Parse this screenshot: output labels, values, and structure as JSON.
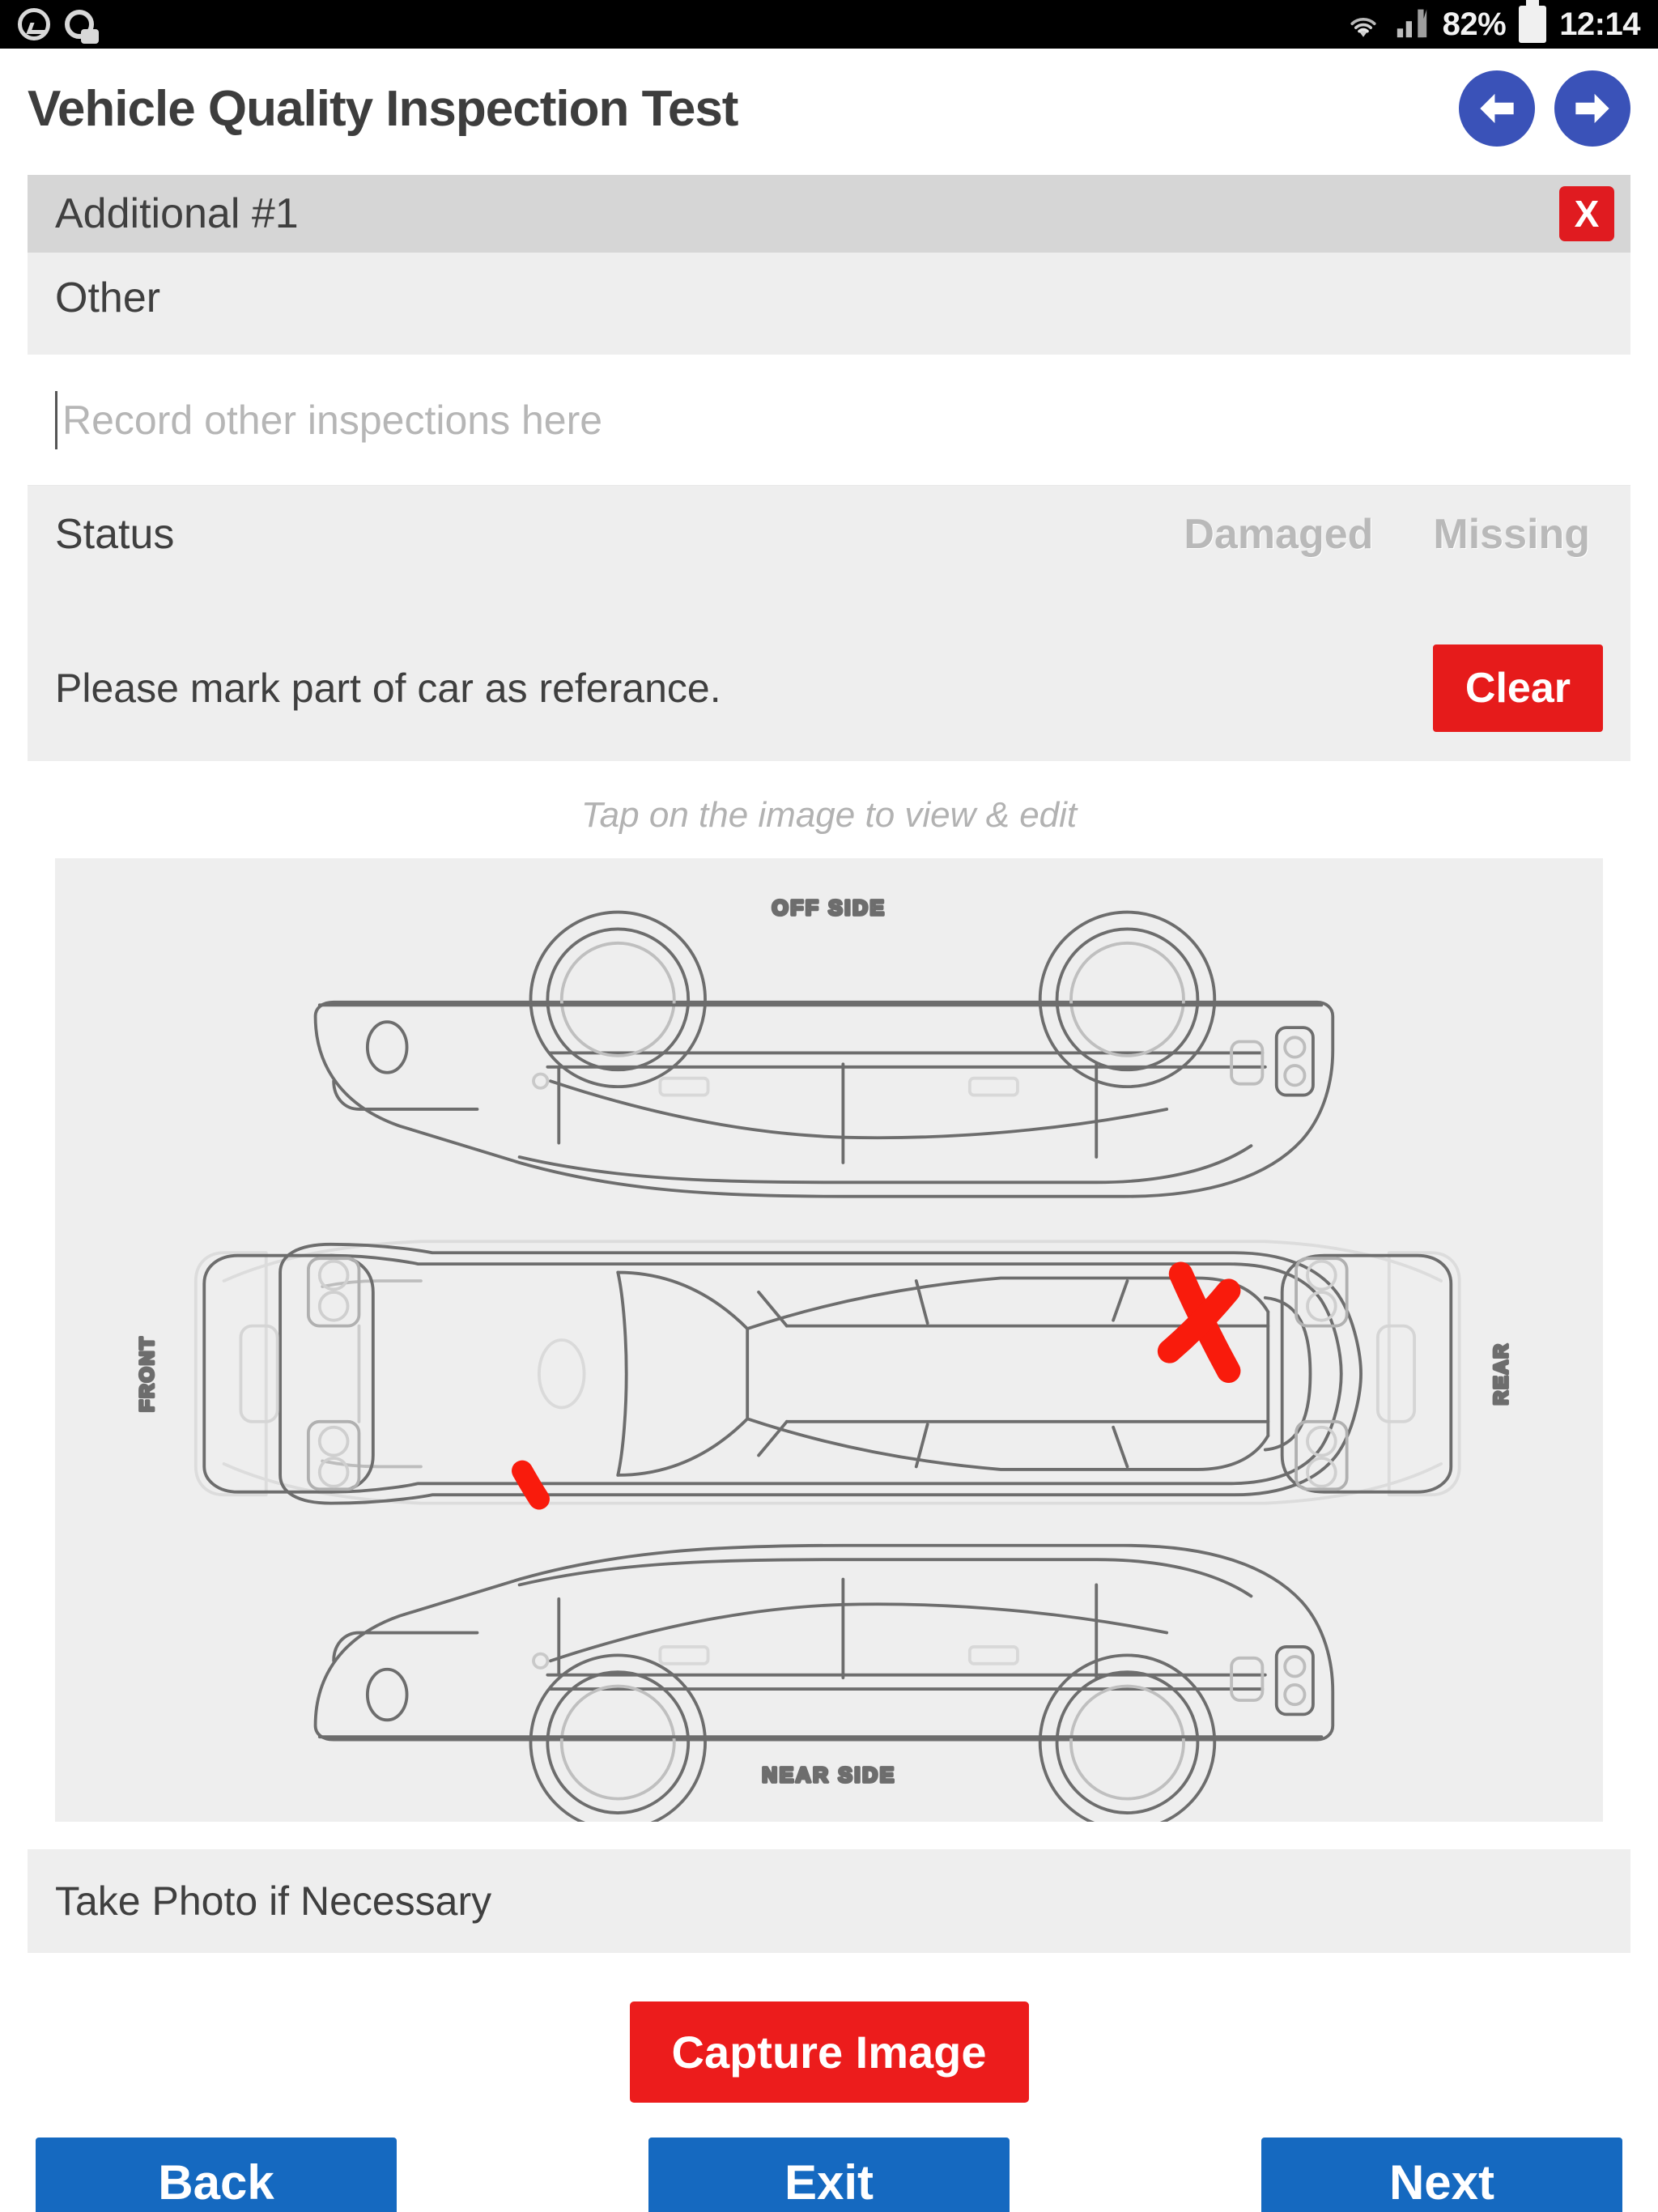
{
  "statusbar": {
    "icons": [
      "sync-icon",
      "app-circle-icon",
      "wifi-icon",
      "signal-icon",
      "battery-icon"
    ],
    "battery_percent": "82%",
    "time": "12:14"
  },
  "header": {
    "title": "Vehicle Quality Inspection Test",
    "back_arrow": "arrow-left-icon",
    "forward_arrow": "arrow-right-icon"
  },
  "section": {
    "heading": "Additional #1",
    "close_label": "X",
    "subheading": "Other"
  },
  "notes": {
    "value": "",
    "placeholder": "Record other inspections here"
  },
  "status": {
    "label": "Status",
    "options": [
      "Damaged",
      "Missing"
    ]
  },
  "marking": {
    "instruction": "Please mark part of car as referance.",
    "clear_label": "Clear",
    "tap_hint": "Tap on the image to view & edit"
  },
  "diagram": {
    "labels": {
      "top": "OFF SIDE",
      "left": "FRONT",
      "right": "REAR",
      "bottom": "NEAR SIDE"
    },
    "marks": [
      {
        "type": "cross",
        "position": "rear-offside-quarter"
      },
      {
        "type": "stroke",
        "position": "front-nearside-wing"
      }
    ],
    "mark_color": "#f91b0c"
  },
  "photo": {
    "label": "Take Photo if Necessary",
    "capture_label": "Capture Image"
  },
  "footer": {
    "buttons": [
      "Back",
      "Exit",
      "Next"
    ]
  },
  "colors": {
    "red": "#e61b1b",
    "blue": "#1569c0",
    "nav_blue": "#3a52b8",
    "panel_grey": "#eeeeee",
    "header_grey": "#d6d6d6"
  }
}
